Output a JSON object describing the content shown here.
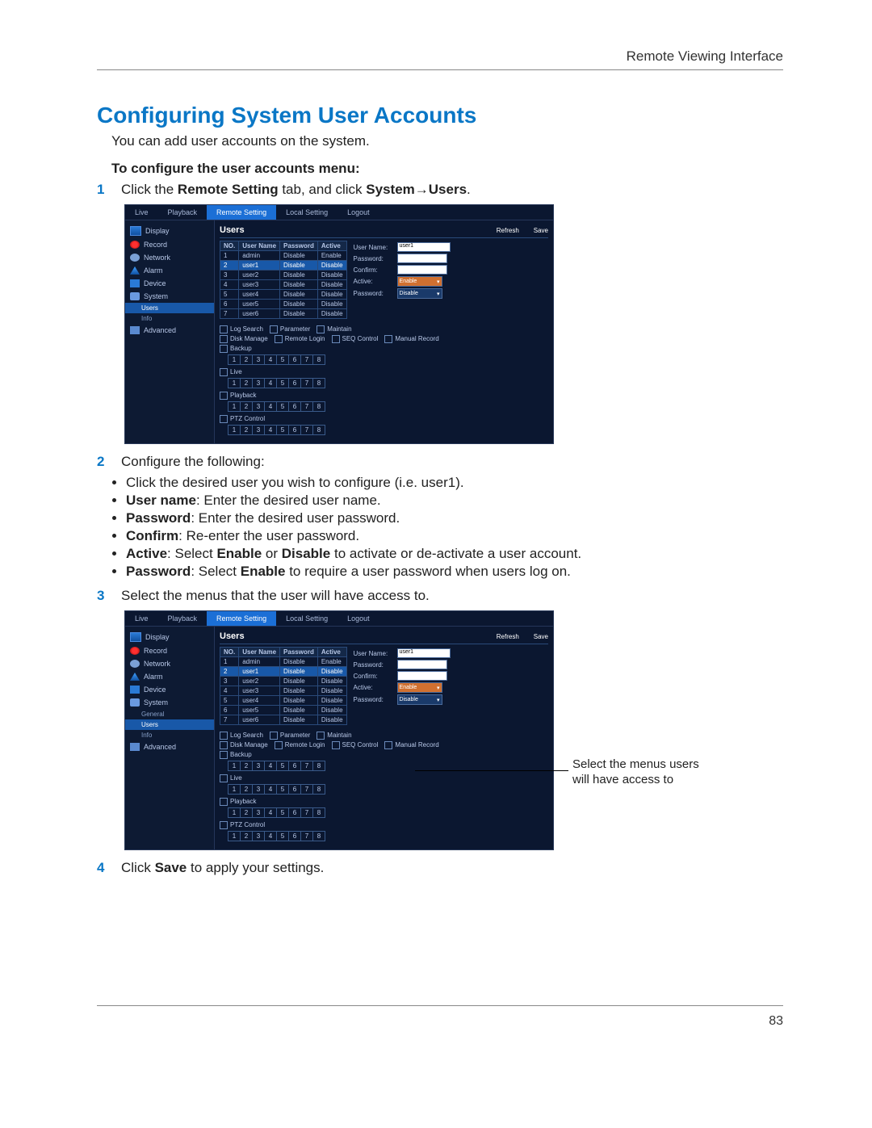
{
  "header": "Remote Viewing Interface",
  "title": "Configuring System User Accounts",
  "intro": "You can add user accounts on the system.",
  "subhead": "To configure the user accounts menu:",
  "step1": {
    "num": "1",
    "pre": "Click the ",
    "b1": "Remote Setting",
    "mid": " tab, and click ",
    "b2": "System",
    "arrow": "→",
    "b3": "Users",
    "post": "."
  },
  "step2": {
    "num": "2",
    "text": "Configure the following:"
  },
  "bullets": [
    {
      "plain": "Click the desired user you wish to configure (i.e. user1)."
    },
    {
      "b": "User name",
      "rest": ": Enter the desired user name."
    },
    {
      "b": "Password",
      "rest": ": Enter the desired user password."
    },
    {
      "b": "Confirm",
      "rest": ": Re-enter the user password."
    },
    {
      "b": "Active",
      "rest": ": Select ",
      "b2": "Enable",
      "mid": " or ",
      "b3": "Disable",
      "tail": " to activate or de-activate a user account."
    },
    {
      "b": "Password",
      "rest": ": Select ",
      "b2": "Enable",
      "tail": " to require a user password when users log on."
    }
  ],
  "step3": {
    "num": "3",
    "text": "Select the menus that the user will have access to."
  },
  "step4": {
    "num": "4",
    "pre": "Click ",
    "b": "Save",
    "post": " to apply your settings."
  },
  "callout": "Select the menus users will have access to",
  "page_number": "83",
  "shot": {
    "tabs": [
      "Live",
      "Playback",
      "Remote Setting",
      "Local Setting",
      "Logout"
    ],
    "active_tab": 2,
    "sidebar": [
      {
        "icon": "display",
        "label": "Display"
      },
      {
        "icon": "record",
        "label": "Record"
      },
      {
        "icon": "network",
        "label": "Network"
      },
      {
        "icon": "alarm",
        "label": "Alarm"
      },
      {
        "icon": "device",
        "label": "Device"
      },
      {
        "icon": "system",
        "label": "System"
      }
    ],
    "system_subs_a": [
      "Users",
      "Info"
    ],
    "system_subs_b": [
      "General",
      "Users",
      "Info"
    ],
    "advanced": {
      "icon": "advanced",
      "label": "Advanced"
    },
    "panel_title": "Users",
    "refresh": "Refresh",
    "save": "Save",
    "cols": [
      "NO.",
      "User Name",
      "Password",
      "Active"
    ],
    "rows": [
      {
        "n": "1",
        "u": "admin",
        "p": "Disable",
        "a": "Enable"
      },
      {
        "n": "2",
        "u": "user1",
        "p": "Disable",
        "a": "Disable",
        "sel": true
      },
      {
        "n": "3",
        "u": "user2",
        "p": "Disable",
        "a": "Disable"
      },
      {
        "n": "4",
        "u": "user3",
        "p": "Disable",
        "a": "Disable"
      },
      {
        "n": "5",
        "u": "user4",
        "p": "Disable",
        "a": "Disable"
      },
      {
        "n": "6",
        "u": "user5",
        "p": "Disable",
        "a": "Disable"
      },
      {
        "n": "7",
        "u": "user6",
        "p": "Disable",
        "a": "Disable"
      }
    ],
    "form": {
      "username_label": "User Name:",
      "username_value": "user1",
      "password_label": "Password:",
      "confirm_label": "Confirm:",
      "active_label": "Active:",
      "active_value": "Enable",
      "pw_label": "Password:",
      "pw_value": "Disable"
    },
    "perms_line1": [
      "Log Search",
      "Parameter",
      "Maintain"
    ],
    "perms_line2": [
      "Disk Manage",
      "Remote Login",
      "SEQ Control",
      "Manual Record"
    ],
    "sections": [
      "Backup",
      "Live",
      "Playback",
      "PTZ Control"
    ],
    "nums": [
      "1",
      "2",
      "3",
      "4",
      "5",
      "6",
      "7",
      "8"
    ]
  }
}
